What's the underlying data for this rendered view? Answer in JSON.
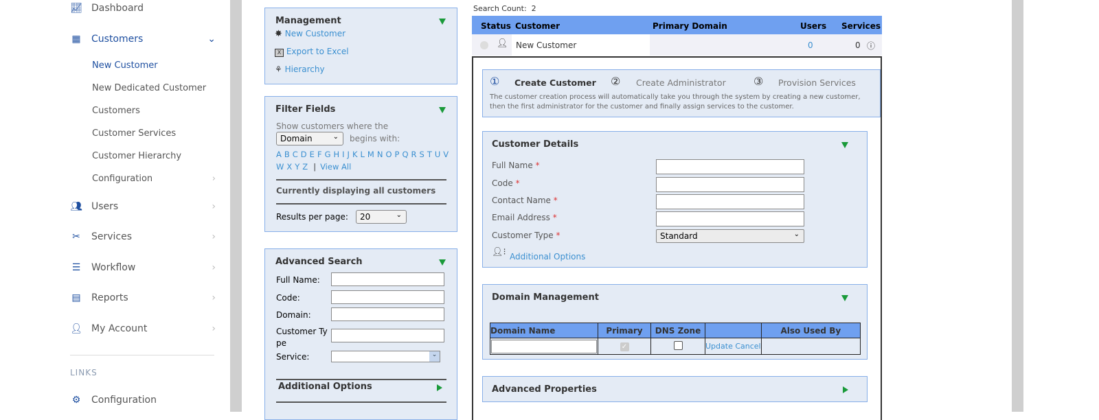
{
  "sidebar": {
    "items": [
      {
        "label": "Dashboard",
        "icon": "chart-line-icon"
      },
      {
        "label": "Customers",
        "icon": "building-icon"
      },
      {
        "label": "Users",
        "icon": "users-icon"
      },
      {
        "label": "Services",
        "icon": "tools-icon"
      },
      {
        "label": "Workflow",
        "icon": "numbered-list-icon"
      },
      {
        "label": "Reports",
        "icon": "report-icon"
      },
      {
        "label": "My Account",
        "icon": "user-icon"
      }
    ],
    "subitems": [
      "New Customer",
      "New Dedicated Customer",
      "Customers",
      "Customer Services",
      "Customer Hierarchy",
      "Configuration"
    ],
    "links_heading": "LINKS",
    "links": [
      {
        "label": "Configuration",
        "icon": "gear-icon"
      }
    ]
  },
  "management": {
    "title": "Management",
    "items": [
      "New Customer",
      "Export to Excel",
      "Hierarchy"
    ]
  },
  "filter": {
    "title": "Filter Fields",
    "prompt": "Show customers where the",
    "field": "Domain",
    "begins": "begins with:",
    "letters1": [
      "A",
      "B",
      "C",
      "D",
      "E",
      "F",
      "G",
      "H",
      "I",
      "J",
      "K",
      "L",
      "M",
      "N",
      "O",
      "P",
      "Q",
      "R",
      "S",
      "T",
      "U",
      "V"
    ],
    "letters2": [
      "W",
      "X",
      "Y",
      "Z"
    ],
    "sep": "|",
    "view_all": "View All",
    "status": "Currently displaying all customers",
    "results_label": "Results per page:",
    "results_value": "20"
  },
  "advanced": {
    "title": "Advanced Search",
    "fields": [
      "Full Name:",
      "Code:",
      "Domain:",
      "Customer Ty pe",
      "Service:"
    ],
    "additional": "Additional Options"
  },
  "results": {
    "count_label": "Search Count:",
    "count": "2",
    "headers": [
      "Status",
      "Customer",
      "Primary Domain",
      "Users",
      "Services"
    ],
    "row": {
      "customer": "New Customer",
      "domain": "",
      "users": "0",
      "services": "0"
    }
  },
  "wizard": {
    "steps": [
      {
        "num": "①",
        "label": "Create Customer"
      },
      {
        "num": "②",
        "label": "Create Administrator"
      },
      {
        "num": "③",
        "label": "Provision Services"
      }
    ],
    "desc1": "The customer creation process will automatically take you through the system by creating a new customer,",
    "desc2": "then the first administrator for the customer and finally assign services to the customer."
  },
  "details": {
    "title": "Customer Details",
    "fields": [
      "Full Name",
      "Code",
      "Contact Name",
      "Email Address",
      "Customer Type"
    ],
    "req": "*",
    "customer_type": "Standard",
    "additional": "Additional Options"
  },
  "domain": {
    "title": "Domain Management",
    "headers": [
      "Domain Name",
      "Primary",
      "DNS Zone",
      "",
      "Also Used By"
    ],
    "update": "Update",
    "cancel": "Cancel"
  },
  "adv_props": {
    "title": "Advanced Properties"
  },
  "colors": {
    "accent": "#1e4fa0",
    "header": "#6fa0f0",
    "panel": "#e4ebf5",
    "green": "#1a9a3a"
  }
}
